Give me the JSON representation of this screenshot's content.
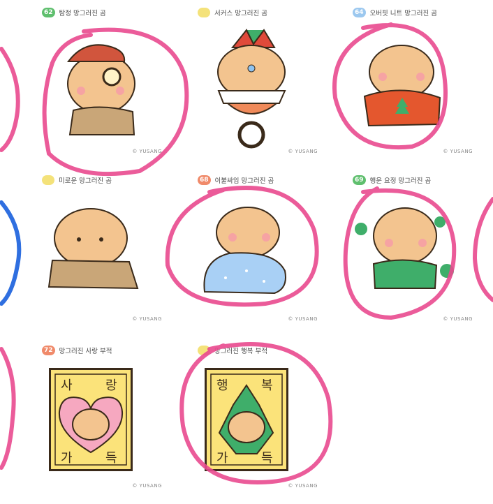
{
  "cards": [
    {
      "num": "62",
      "badge_color": "#5fbf6e",
      "title": "탐정 망그러진 곰",
      "credit": "© YUSANG"
    },
    {
      "num": "",
      "badge_color": "#f4e27a",
      "title": "서커스 망그러진 곰",
      "credit": "© YUSANG"
    },
    {
      "num": "64",
      "badge_color": "#9cc8ef",
      "title": "오버핏 니트 망그러진 곰",
      "credit": "© YUSANG"
    },
    {
      "num": "",
      "badge_color": "#f4e27a",
      "title": "미로운 망그러진 곰",
      "credit": "© YUSANG"
    },
    {
      "num": "68",
      "badge_color": "#f08a6a",
      "title": "이불싸임 망그러진 곰",
      "credit": "© YUSANG"
    },
    {
      "num": "69",
      "badge_color": "#5fbf6e",
      "title": "행운 요정 망그러진 곰",
      "credit": "© YUSANG"
    },
    {
      "num": "72",
      "badge_color": "#f08a6a",
      "title": "망그러진 사랑 부적",
      "credit": "© YUSANG"
    },
    {
      "num": "",
      "badge_color": "#f4e27a",
      "title": "망그러진 행복 부적",
      "credit": "© YUSANG"
    }
  ],
  "charms": {
    "love": {
      "top_left": "사",
      "top_right": "랑",
      "bottom_left": "가",
      "bottom_right": "득"
    },
    "happy": {
      "top_left": "행",
      "top_right": "복",
      "bottom_left": "가",
      "bottom_right": "득"
    }
  },
  "colors": {
    "pink_marker": "#e94a8f",
    "blue_marker": "#2f6fe0",
    "bear_fur": "#f3c48f",
    "outline": "#3a2a1a"
  }
}
